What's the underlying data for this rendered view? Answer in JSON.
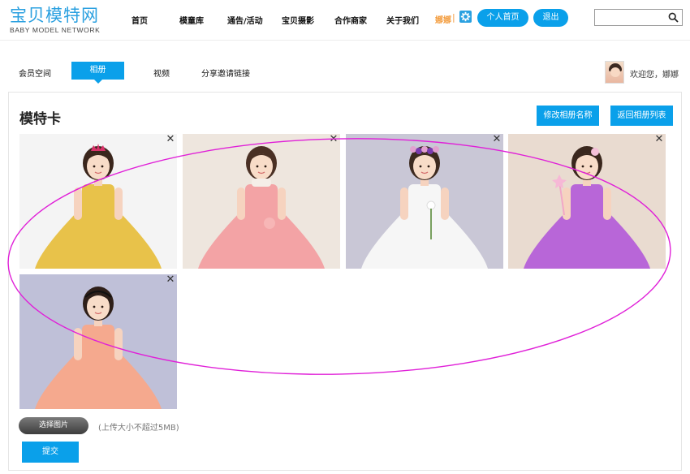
{
  "header": {
    "logo_cn": "宝贝模特网",
    "logo_en": "BABY MODEL NETWORK",
    "nav": [
      "首页",
      "模童库",
      "通告/活动",
      "宝贝摄影",
      "合作商家",
      "关于我们"
    ],
    "username": "娜娜",
    "separator": "|",
    "gear_icon": "gear-icon",
    "profile_button": "个人首页",
    "logout_button": "退出",
    "search_placeholder": "",
    "search_icon": "search-icon"
  },
  "subnav": {
    "tabs": [
      "会员空间",
      "相册",
      "视频",
      "分享邀请链接"
    ],
    "active_tab": "相册",
    "welcome": "欢迎您，娜娜"
  },
  "album": {
    "title": "模特卡",
    "rename_button": "修改相册名称",
    "back_button": "返回相册列表",
    "close_symbol": "✕",
    "photos": [
      {
        "dress": "#e8c24a",
        "bg": "#f4f4f4",
        "hair": "#3a261c",
        "accessory": "tiara"
      },
      {
        "dress": "#f3a3a5",
        "bg": "#eee6de",
        "hair": "#4a3024",
        "accessory": "scarf"
      },
      {
        "dress": "#f6f6f6",
        "bg": "#c9c7d6",
        "hair": "#3d2a20",
        "accessory": "flowers"
      },
      {
        "dress": "#b866d8",
        "bg": "#e9dbd0",
        "hair": "#3a271d",
        "accessory": "wand"
      },
      {
        "dress": "#f5a98e",
        "bg": "#bfc0d8",
        "hair": "#2e1f19",
        "accessory": "headband"
      }
    ]
  },
  "upload": {
    "choose_button": "选择图片",
    "hint": "(上传大小不超过5MB)",
    "submit_button": "提交"
  },
  "colors": {
    "accent": "#0aa0ea",
    "logo": "#2aa0e0",
    "username": "#f39c3d",
    "annotation": "#e020d8"
  }
}
